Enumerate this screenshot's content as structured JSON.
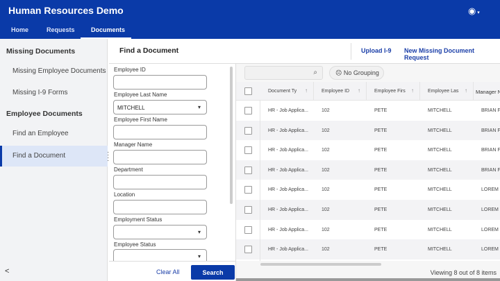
{
  "app": {
    "title": "Human Resources Demo",
    "user_icon": "user-circle-icon"
  },
  "nav": [
    {
      "label": "Home"
    },
    {
      "label": "Requests"
    },
    {
      "label": "Documents",
      "active": true
    }
  ],
  "sidebar": {
    "sections": [
      {
        "heading": "Missing Documents",
        "items": [
          "Missing Employee Documents",
          "Missing I-9 Forms"
        ]
      },
      {
        "heading": "Employee Documents",
        "items": [
          "Find an Employee",
          "Find a Document"
        ]
      }
    ],
    "selected": "Find a Document",
    "collapse": "<"
  },
  "page": {
    "title": "Find a Document",
    "links": [
      "Upload I-9",
      "New Missing Document Request"
    ]
  },
  "form": {
    "fields": [
      {
        "label": "Employee ID",
        "value": "",
        "type": "text"
      },
      {
        "label": "Employee Last Name",
        "value": "MITCHELL",
        "type": "dropdown"
      },
      {
        "label": "Employee First Name",
        "value": "",
        "type": "text"
      },
      {
        "label": "Manager Name",
        "value": "",
        "type": "text"
      },
      {
        "label": "Department",
        "value": "",
        "type": "text"
      },
      {
        "label": "Location",
        "value": "",
        "type": "text"
      },
      {
        "label": "Employment Status",
        "value": "",
        "type": "dropdown"
      },
      {
        "label": "Employee Status",
        "value": "",
        "type": "dropdown"
      }
    ],
    "clear_label": "Clear All",
    "search_label": "Search"
  },
  "grid": {
    "search_placeholder": "",
    "grouping_label": "No Grouping",
    "columns": [
      "Document Ty",
      "Employee ID",
      "Employee Firs",
      "Employee Las",
      "Manager N"
    ],
    "rows": [
      [
        "HR - Job Applica...",
        "102",
        "PETE",
        "MITCHELL",
        "BRIAN FL"
      ],
      [
        "HR - Job Applica...",
        "102",
        "PETE",
        "MITCHELL",
        "BRIAN FL"
      ],
      [
        "HR - Job Applica...",
        "102",
        "PETE",
        "MITCHELL",
        "BRIAN FL"
      ],
      [
        "HR - Job Applica...",
        "102",
        "PETE",
        "MITCHELL",
        "BRIAN FL"
      ],
      [
        "HR - Job Applica...",
        "102",
        "PETE",
        "MITCHELL",
        "LOREM IF"
      ],
      [
        "HR - Job Applica...",
        "102",
        "PETE",
        "MITCHELL",
        "LOREM IF"
      ],
      [
        "HR - Job Applica...",
        "102",
        "PETE",
        "MITCHELL",
        "LOREM IF"
      ],
      [
        "HR - Job Applica...",
        "102",
        "PETE",
        "MITCHELL",
        "LOREM IF"
      ]
    ],
    "footer": "Viewing 8 out of 8 items"
  },
  "colors": {
    "brand": "#0a3aa8",
    "selected_bg": "#dde6f7"
  }
}
